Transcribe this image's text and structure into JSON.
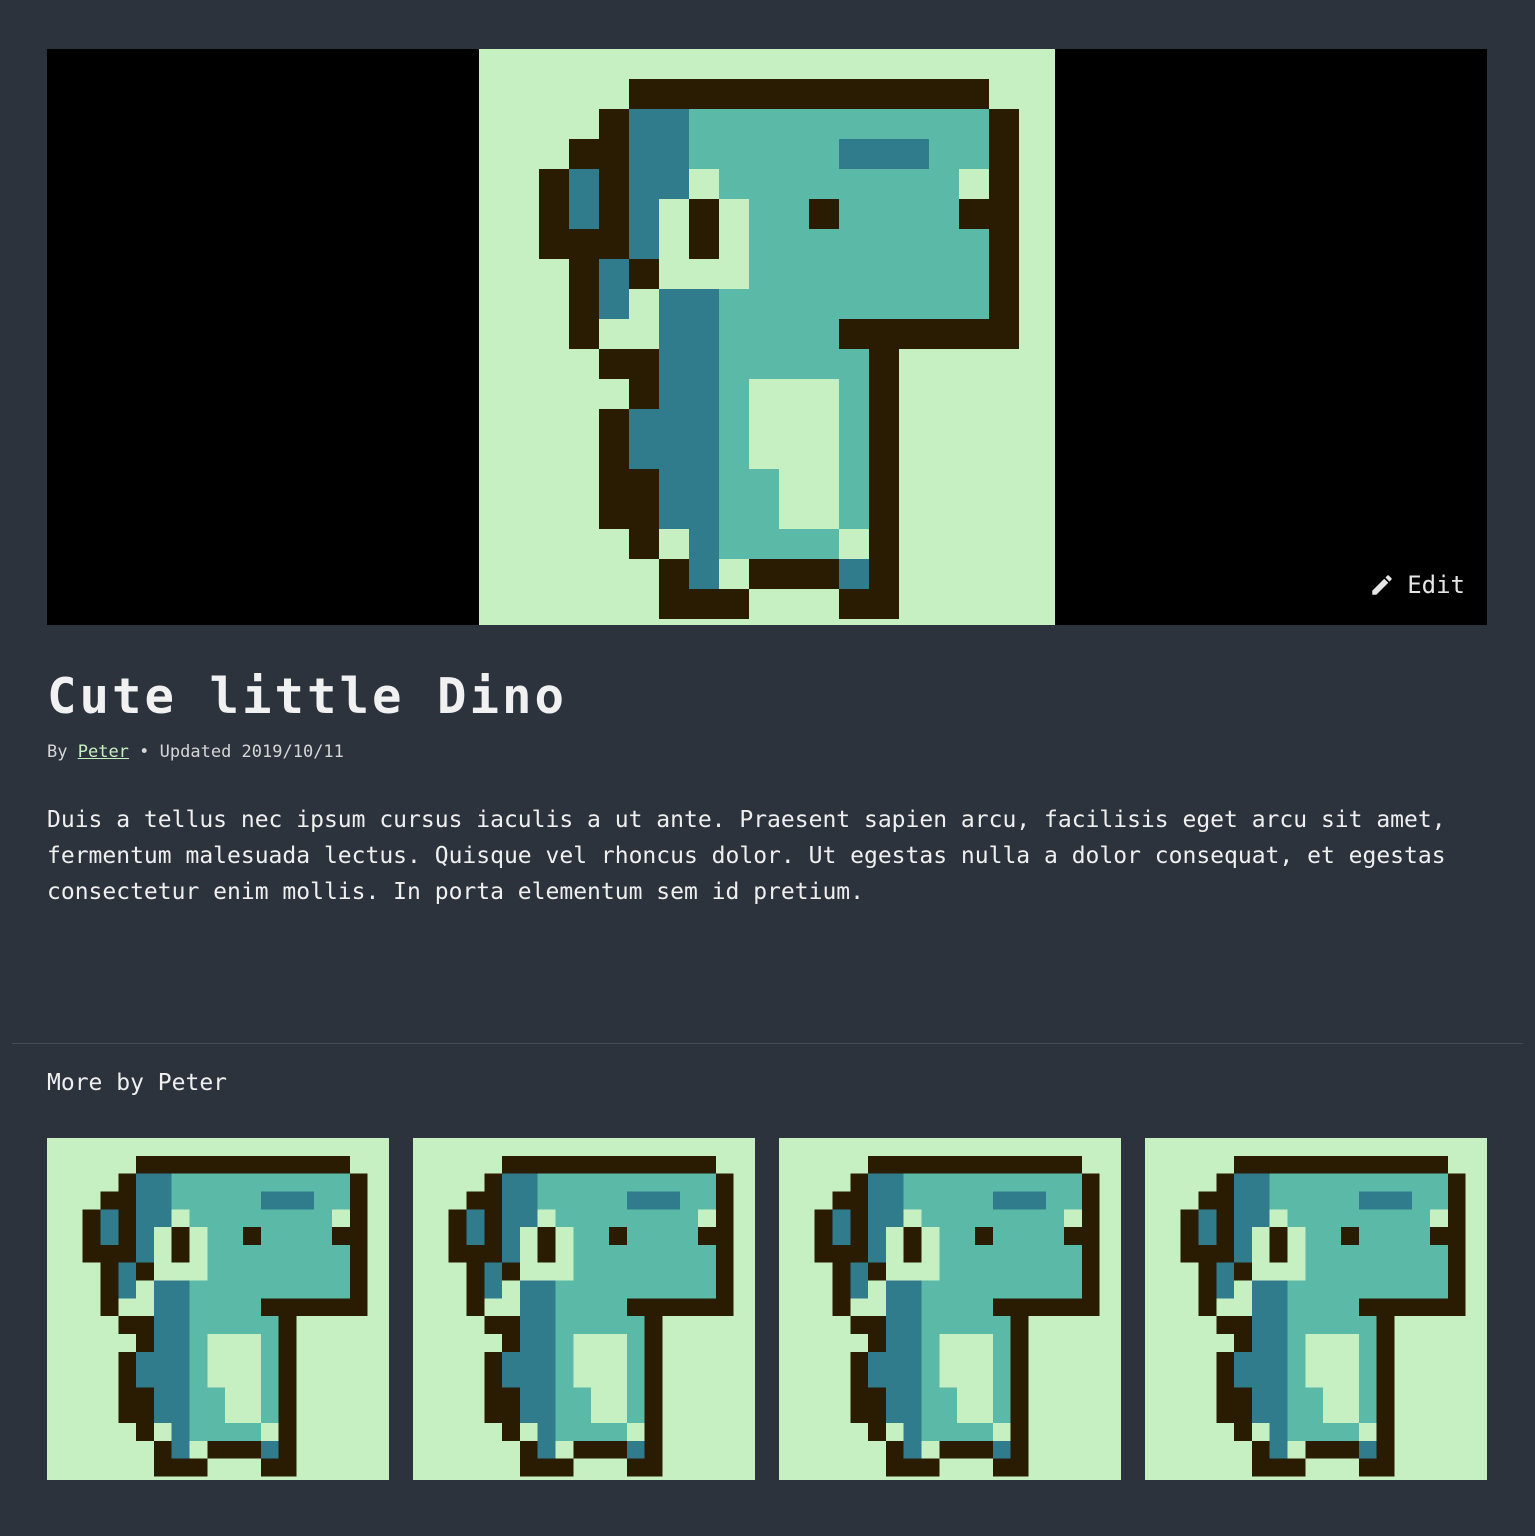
{
  "hero": {
    "image_alt": "Cute little Dino pixel art",
    "edit_label": "Edit"
  },
  "post": {
    "title": "Cute little Dino",
    "by_label": "By",
    "author": "Peter",
    "separator": "•",
    "updated_label": "Updated 2019/10/11",
    "description": "Duis a tellus nec ipsum cursus iaculis a ut ante. Praesent sapien arcu, facilisis eget arcu sit amet, fermentum malesuada lectus. Quisque vel rhoncus dolor. Ut egestas nulla a dolor consequat, et egestas consectetur enim mollis. In porta elementum sem id pretium."
  },
  "more": {
    "title": "More by Peter",
    "items": [
      {
        "alt": "Cute little Dino"
      },
      {
        "alt": "Cute little Dino"
      },
      {
        "alt": "Cute little Dino"
      },
      {
        "alt": "Cute little Dino"
      }
    ]
  },
  "colors": {
    "page_bg": "#2d333d",
    "art_bg": "#c6f0c2",
    "outline": "#2a1b03",
    "body_light": "#5bb9a8",
    "body_dark": "#307b8c",
    "belly": "#c6f0c2",
    "link": "#c6f0c2"
  }
}
